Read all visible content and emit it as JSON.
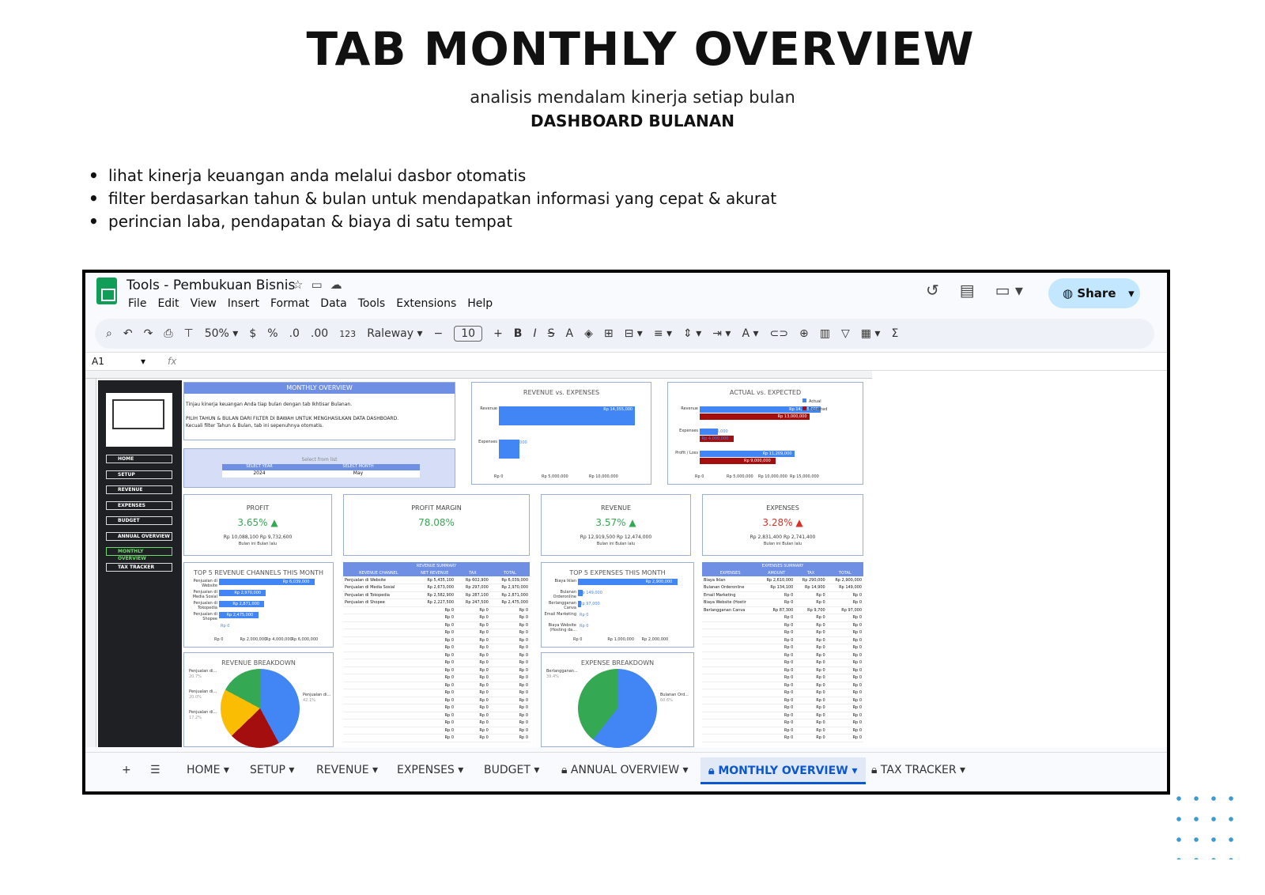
{
  "slide": {
    "title": "TAB MONTHLY OVERVIEW",
    "subtitle": "analisis mendalam kinerja setiap bulan",
    "subtitle2": "DASHBOARD BULANAN",
    "bullets": [
      "lihat kinerja keuangan anda melalui dasbor otomatis",
      "filter berdasarkan tahun & bulan untuk mendapatkan informasi yang cepat & akurat",
      "perincian laba, pendapatan & biaya di satu tempat"
    ]
  },
  "app": {
    "title": "Tools - Pembukuan Bisnis",
    "menu": [
      "File",
      "Edit",
      "View",
      "Insert",
      "Format",
      "Data",
      "Tools",
      "Extensions",
      "Help"
    ],
    "share_label": "Share",
    "zoom": "50%",
    "font": "Raleway",
    "font_size": "10",
    "cell_ref": "A1",
    "fx": "fx",
    "toolbar_currency": "$",
    "toolbar_percent": "%",
    "toolbar_decimal_dec": ".0",
    "toolbar_decimal_inc": ".00",
    "toolbar_format_num": "123",
    "icons": [
      "search-icon",
      "undo-icon",
      "redo-icon",
      "print-icon",
      "paint-format-icon",
      "bold-icon",
      "italic-icon",
      "strikethrough-icon",
      "text-color-icon",
      "fill-color-icon",
      "borders-icon",
      "merge-icon",
      "align-icon",
      "link-icon",
      "comment-icon",
      "chart-icon",
      "filter-icon",
      "function-icon",
      "history-icon",
      "chat-icon",
      "video-icon",
      "star-icon",
      "folder-icon",
      "cloud-icon",
      "globe-icon"
    ],
    "accent": "#c2e7ff"
  },
  "sidebar": {
    "items": [
      "HOME",
      "SETUP",
      "REVENUE",
      "EXPENSES",
      "BUDGET",
      "ANNUAL OVERVIEW",
      "MONTHLY OVERVIEW",
      "TAX TRACKER"
    ],
    "active": "MONTHLY OVERVIEW"
  },
  "dashboard": {
    "header": "MONTHLY OVERVIEW",
    "intro1": "Tinjau kinerja keuangan Anda tiap bulan dengan tab Ikhtisar Bulanan.",
    "intro2": "PILIH TAHUN & BULAN DARI FILTER DI BAWAH UNTUK MENGHASILKAN DATA DASHBOARD.",
    "intro3": "Kecuali filter Tahun & Bulan, tab ini sepenuhnya otomatis.",
    "filter_hint": "Select from list",
    "year_label": "SELECT YEAR",
    "month_label": "SELECT MONTH",
    "year": "2024",
    "month": "May",
    "cards": [
      {
        "title": "PROFIT",
        "value": "3.65% ▲",
        "this": "Rp 10,088,100",
        "last": "Rp 9,732,600",
        "this_label": "Bulan ini",
        "last_label": "Bulan lalu",
        "color": "#34a853"
      },
      {
        "title": "PROFIT MARGIN",
        "value": "78.08%",
        "color": "#34a853"
      },
      {
        "title": "REVENUE",
        "value": "3.57% ▲",
        "this": "Rp 12,919,500",
        "last": "Rp 12,474,000",
        "this_label": "Bulan ini",
        "last_label": "Bulan lalu",
        "color": "#34a853"
      },
      {
        "title": "EXPENSES",
        "value": "3.28% ▲",
        "this": "Rp 2,831,400",
        "last": "Rp 2,741,400",
        "this_label": "Bulan ini",
        "last_label": "Bulan lalu",
        "color": "#d93025"
      }
    ],
    "rev_summary_title": "REVENUE SUMMARY",
    "rev_headers": [
      "REVENUE CHANNEL",
      "NET REVENUE",
      "TAX",
      "TOTAL"
    ],
    "rev_rows": [
      [
        "Penjualan di Website",
        "Rp 5,435,100",
        "Rp 602,900",
        "Rp 6,039,000"
      ],
      [
        "Penjualan di Media Sosial",
        "Rp 2,673,000",
        "Rp 297,000",
        "Rp 2,970,000"
      ],
      [
        "Penjualan di Tokopedia",
        "Rp 2,582,900",
        "Rp 287,100",
        "Rp 2,871,000"
      ],
      [
        "Penjualan di Shopee",
        "Rp 2,227,500",
        "Rp 247,500",
        "Rp 2,475,000"
      ]
    ],
    "exp_summary_title": "EXPENSES SUMMARY",
    "exp_headers": [
      "EXPENSES",
      "AMOUNT",
      "TAX",
      "TOTAL"
    ],
    "exp_rows": [
      [
        "Biaya Iklan",
        "Rp 2,610,000",
        "Rp 290,000",
        "Rp 2,900,000"
      ],
      [
        "Bulanan Orderonline",
        "Rp 134,100",
        "Rp 14,900",
        "Rp 149,000"
      ],
      [
        "Email Marketing",
        "Rp 0",
        "Rp 0",
        "Rp 0"
      ],
      [
        "Biaya Website (Hostir",
        "Rp 0",
        "Rp 0",
        "Rp 0"
      ],
      [
        "Berlangganan Canva",
        "Rp 87,300",
        "Rp 9,700",
        "Rp 97,000"
      ]
    ],
    "zero": "Rp 0"
  },
  "chart_data": [
    {
      "type": "bar",
      "title": "REVENUE vs. EXPENSES",
      "categories": [
        "Revenue",
        "Expenses"
      ],
      "values": [
        14355000,
        2146000
      ],
      "data_labels": [
        "Rp 14,355,000",
        "Rp 2,146,000"
      ],
      "ticks": [
        "Rp 0",
        "Rp 5,000,000",
        "Rp 10,000,000"
      ],
      "xlim": [
        0,
        15000000
      ]
    },
    {
      "type": "bar",
      "title": "ACTUAL vs. EXPECTED",
      "categories": [
        "Revenue",
        "Expenses",
        "Profit / Loss"
      ],
      "series": [
        {
          "name": "Actual",
          "values": [
            14355000,
            2146000,
            11209000
          ],
          "labels": [
            "Rp 14,355,000",
            "Rp 2,146,000",
            "Rp 11,209,000"
          ]
        },
        {
          "name": "Expected",
          "values": [
            13000000,
            4000000,
            9000000
          ],
          "labels": [
            "Rp 13,000,000",
            "Rp 4,000,000",
            "Rp 9,000,000"
          ]
        }
      ],
      "ticks": [
        "Rp 0",
        "Rp 5,000,000",
        "Rp 10,000,000",
        "Rp 15,000,000"
      ],
      "xlim": [
        0,
        15000000
      ],
      "colors": [
        "#4285f4",
        "#a50e0e"
      ]
    },
    {
      "type": "bar",
      "title": "TOP 5 REVENUE CHANNELS THIS MONTH",
      "categories": [
        "Penjualan di Website",
        "Penjualan di Media Sosial",
        "Penjualan di Tokopedia",
        "Penjualan di Shopee",
        ""
      ],
      "values": [
        6039000,
        2970000,
        2871000,
        2475000,
        0
      ],
      "data_labels": [
        "Rp 6,039,000",
        "Rp 2,970,000",
        "Rp 2,871,000",
        "Rp 2,475,000",
        "Rp 0"
      ],
      "ticks": [
        "Rp 0",
        "Rp 2,000,000",
        "Rp 4,000,000",
        "Rp 6,000,000"
      ],
      "xlim": [
        0,
        6500000
      ]
    },
    {
      "type": "bar",
      "title": "TOP 5 EXPENSES THIS MONTH",
      "categories": [
        "Biaya Iklan",
        "Bulanan Orderonline",
        "Berlangganan Canva",
        "Email Marketing",
        "Biaya Website (Hosting da..."
      ],
      "values": [
        2900000,
        149000,
        97000,
        0,
        0
      ],
      "data_labels": [
        "Rp 2,900,000",
        "Rp 149,000",
        "Rp 97,000",
        "Rp 0",
        "Rp 0"
      ],
      "ticks": [
        "Rp 0",
        "Rp 1,000,000",
        "Rp 2,000,000"
      ],
      "xlim": [
        0,
        3000000
      ]
    },
    {
      "type": "pie",
      "title": "REVENUE BREAKDOWN",
      "labels": [
        "Penjualan di...",
        "Penjualan di...",
        "Penjualan di...",
        "Penjualan di..."
      ],
      "values": [
        42.1,
        20.7,
        20.0,
        17.2
      ],
      "pct_labels": [
        "42.1%",
        "20.7%",
        "20.0%",
        "17.2%"
      ],
      "colors": [
        "#4285f4",
        "#a50e0e",
        "#fbbc04",
        "#34a853"
      ]
    },
    {
      "type": "pie",
      "title": "EXPENSE BREAKDOWN",
      "labels": [
        "Bulanan Ord...",
        "Berlangganan..."
      ],
      "values": [
        60.6,
        39.4
      ],
      "pct_labels": [
        "60.6%",
        "39.4%"
      ],
      "colors": [
        "#4285f4",
        "#34a853"
      ]
    }
  ],
  "tabs": [
    {
      "label": "HOME",
      "locked": false
    },
    {
      "label": "SETUP",
      "locked": false
    },
    {
      "label": "REVENUE",
      "locked": false
    },
    {
      "label": "EXPENSES",
      "locked": false
    },
    {
      "label": "BUDGET",
      "locked": false
    },
    {
      "label": "ANNUAL OVERVIEW",
      "locked": true
    },
    {
      "label": "MONTHLY OVERVIEW",
      "locked": true,
      "active": true
    },
    {
      "label": "TAX TRACKER",
      "locked": true
    }
  ]
}
